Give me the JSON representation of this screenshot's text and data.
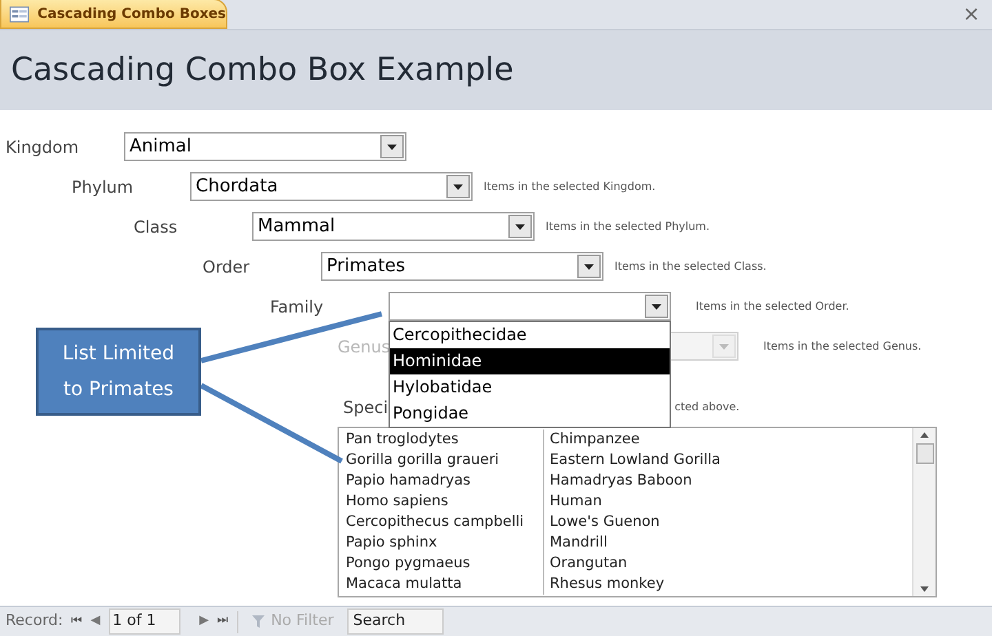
{
  "window": {
    "tab_title": "Cascading Combo Boxes",
    "close": "×"
  },
  "header": {
    "title": "Cascading Combo Box Example"
  },
  "fields": [
    {
      "label": "Kingdom",
      "value": "Animal",
      "disabled": false
    },
    {
      "label": "Phylum",
      "value": "Chordata",
      "hint": "Items in the selected Kingdom.",
      "disabled": false
    },
    {
      "label": "Class",
      "value": "Mammal",
      "hint": "Items in the selected Phylum.",
      "disabled": false
    },
    {
      "label": "Order",
      "value": "Primates",
      "hint": "Items in the selected Class.",
      "disabled": false
    },
    {
      "label": "Family",
      "hint": "Items in the selected Order.",
      "disabled": false,
      "open": true
    },
    {
      "label": "Genus",
      "hint": "Items in the selected Genus.",
      "disabled": true
    }
  ],
  "dropdown": [
    {
      "label": "Cercopithecidae",
      "selected": false
    },
    {
      "label": "Hominidae",
      "selected": true
    },
    {
      "label": "Hylobatidae",
      "selected": false
    },
    {
      "label": "Pongidae",
      "selected": false
    }
  ],
  "species": {
    "label": "Speci",
    "hint": "cted above.",
    "rows": [
      [
        "Pan troglodytes",
        "Chimpanzee"
      ],
      [
        "Gorilla gorilla graueri",
        "Eastern Lowland Gorilla"
      ],
      [
        "Papio hamadryas",
        "Hamadryas Baboon"
      ],
      [
        "Homo sapiens",
        "Human"
      ],
      [
        "Cercopithecus campbelli",
        "Lowe's Guenon"
      ],
      [
        "Papio sphinx",
        "Mandrill"
      ],
      [
        "Pongo pygmaeus",
        "Orangutan"
      ],
      [
        "Macaca mulatta",
        "Rhesus monkey"
      ]
    ]
  },
  "callout": {
    "text": "List Limited to Primates"
  },
  "status_bar": {
    "record_label": "Record:",
    "first": "⏮",
    "prev": "◀",
    "position": "1 of 1",
    "next": "▶",
    "last": "⏭",
    "filter": "No Filter",
    "search": "Search"
  }
}
